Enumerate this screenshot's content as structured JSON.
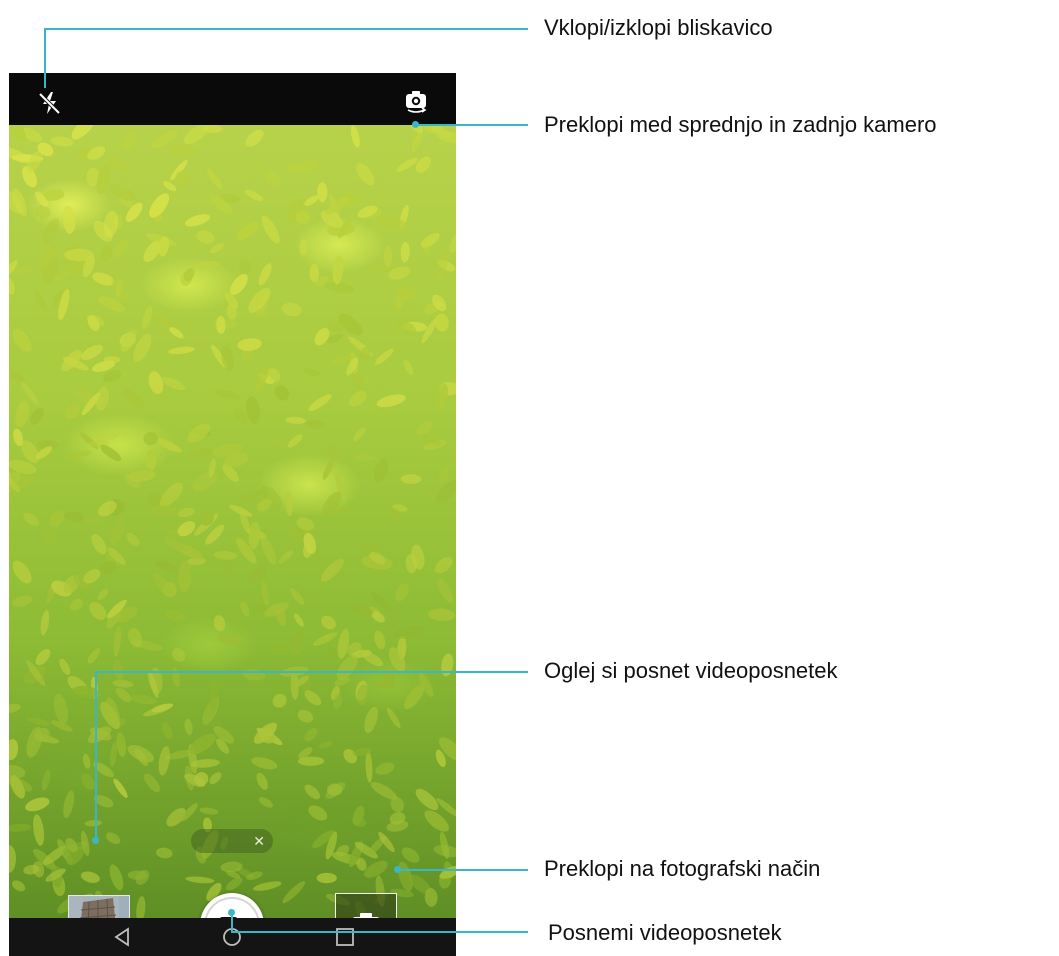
{
  "callouts": {
    "flash": "Vklopi/izklopi bliskavico",
    "switch_camera": "Preklopi med sprednjo in zadnjo kamero",
    "view_video": "Oglej si posnet videoposnetek",
    "photo_mode": "Preklopi na fotografski način",
    "record": "Posnemi videoposnetek"
  },
  "icons": {
    "flash": "flash-off-icon",
    "switch": "switch-camera-icon",
    "record": "video-camera-icon",
    "photo": "camera-icon",
    "back": "back-triangle-icon",
    "home": "home-circle-icon",
    "recents": "recents-square-icon",
    "close": "close-icon"
  },
  "pill": {
    "close": "✕"
  },
  "colors": {
    "accent": "#39b7c6",
    "foliage": "#a8cb3f"
  }
}
